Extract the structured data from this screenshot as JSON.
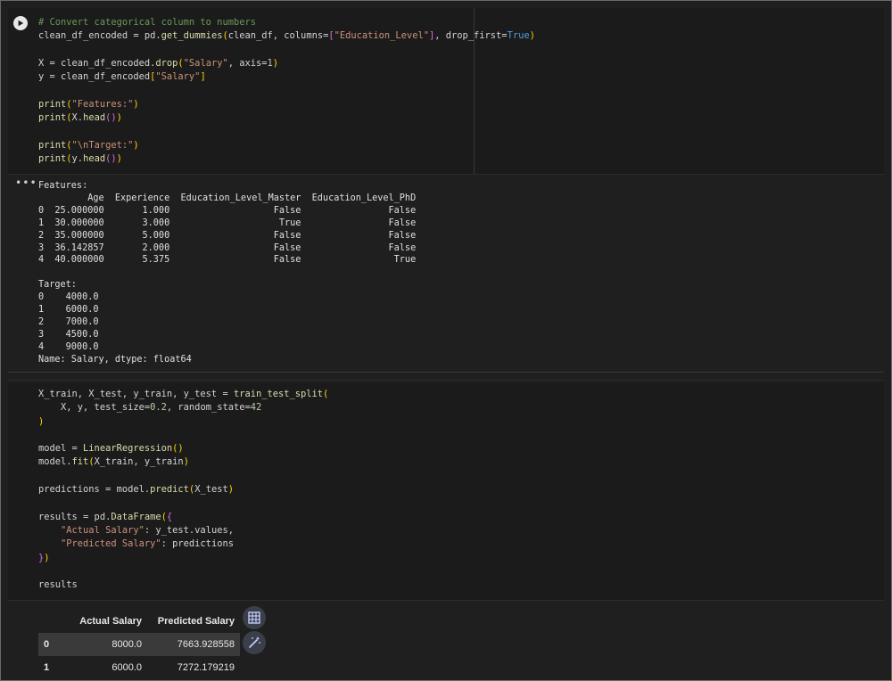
{
  "cell1": {
    "lines": [
      "# Convert categorical column to numbers",
      "clean_df_encoded = pd.get_dummies(clean_df, columns=[\"Education_Level\"], drop_first=True)",
      "",
      "X = clean_df_encoded.drop(\"Salary\", axis=1)",
      "y = clean_df_encoded[\"Salary\"]",
      "",
      "print(\"Features:\")",
      "print(X.head())",
      "",
      "print(\"\\nTarget:\")",
      "print(y.head())"
    ]
  },
  "output1": {
    "dots": "•••",
    "text": "Features:\n         Age  Experience  Education_Level_Master  Education_Level_PhD\n0  25.000000       1.000                   False                False\n1  30.000000       3.000                    True                False\n2  35.000000       5.000                   False                False\n3  36.142857       2.000                   False                False\n4  40.000000       5.375                   False                 True\n\nTarget:\n0    4000.0\n1    6000.0\n2    7000.0\n3    4500.0\n4    9000.0\nName: Salary, dtype: float64"
  },
  "cell2": {
    "lines": [
      "X_train, X_test, y_train, y_test = train_test_split(",
      "    X, y, test_size=0.2, random_state=42",
      ")",
      "",
      "model = LinearRegression()",
      "model.fit(X_train, y_train)",
      "",
      "predictions = model.predict(X_test)",
      "",
      "results = pd.DataFrame({",
      "    \"Actual Salary\": y_test.values,",
      "    \"Predicted Salary\": predictions",
      "})",
      "",
      "results"
    ]
  },
  "output2": {
    "columns": [
      "",
      "Actual Salary",
      "Predicted Salary"
    ],
    "rows": [
      {
        "index": "0",
        "actual": "8000.0",
        "predicted": "7663.928558"
      },
      {
        "index": "1",
        "actual": "6000.0",
        "predicted": "7272.179219"
      }
    ],
    "tools": [
      "table-icon",
      "magic-wand-icon"
    ]
  },
  "colors": {
    "background": "#1f1f1f",
    "code_bg": "#1b1b1c",
    "comment": "#6a9955",
    "string": "#ce9178",
    "keyword": "#569cd6",
    "function": "#dcdcaa"
  }
}
